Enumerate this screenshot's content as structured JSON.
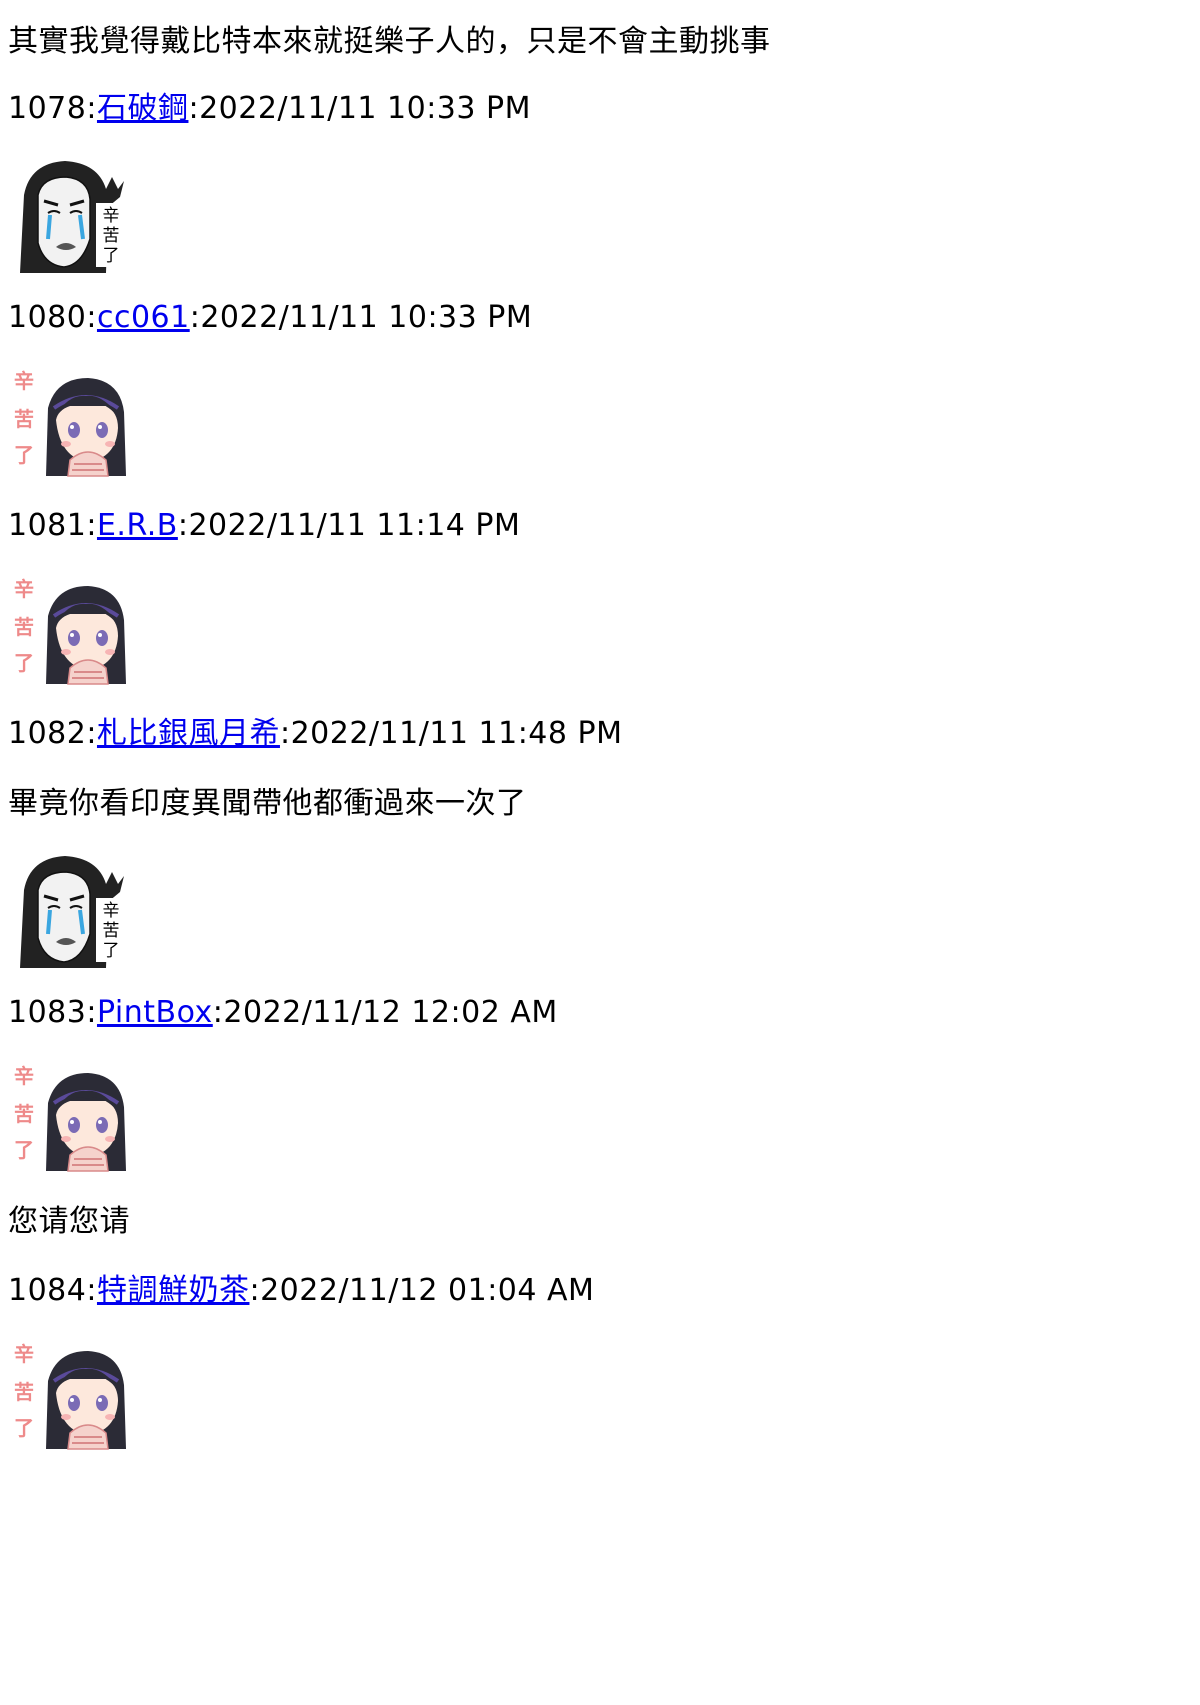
{
  "posts": [
    {
      "body": "其實我覺得戴比特本來就挺樂子人的，只是不會主動挑事"
    },
    {
      "number": "1078",
      "user": "石破鋼",
      "time": "2022/11/11 10:33 PM",
      "sticker": "crying-man-sticker",
      "sticker_text": "辛苦了"
    },
    {
      "number": "1080",
      "user": "cc061",
      "time": "2022/11/11 10:33 PM",
      "sticker": "anime-girl-sticker",
      "sticker_text": "辛苦了"
    },
    {
      "number": "1081",
      "user": "E.R.B",
      "time": "2022/11/11 11:14 PM",
      "sticker": "anime-girl-sticker",
      "sticker_text": "辛苦了"
    },
    {
      "number": "1082",
      "user": "札比銀風月希",
      "time": "2022/11/11 11:48 PM",
      "body": "畢竟你看印度異聞帶他都衝過來一次了",
      "sticker": "crying-man-sticker",
      "sticker_text": "辛苦了"
    },
    {
      "number": "1083",
      "user": "PintBox",
      "time": "2022/11/12 12:02 AM",
      "sticker": "anime-girl-sticker",
      "sticker_text": "辛苦了",
      "body": "您请您请"
    },
    {
      "number": "1084",
      "user": "特調鮮奶茶",
      "time": "2022/11/12 01:04 AM",
      "sticker": "anime-girl-sticker",
      "sticker_text": "辛苦了"
    }
  ],
  "colors": {
    "link": "#0000ee",
    "text": "#000000",
    "background": "#ffffff",
    "sticker_pink": "#ee8a8a"
  }
}
